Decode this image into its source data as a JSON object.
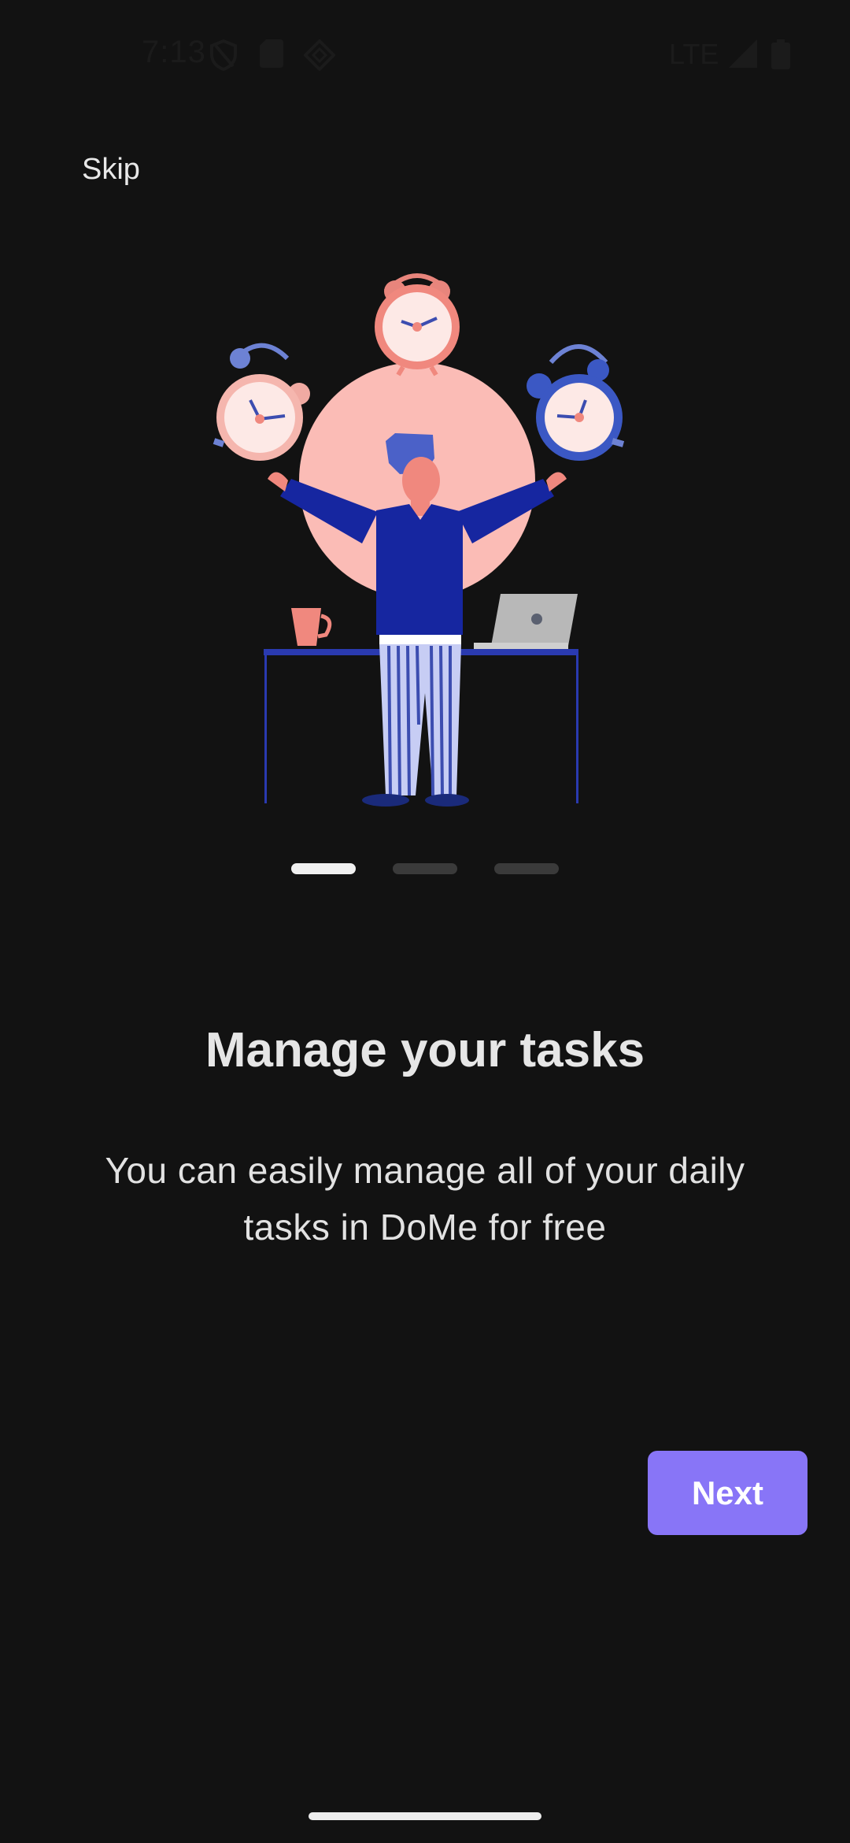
{
  "status_bar": {
    "time": "7:13",
    "network": "LTE",
    "icons": [
      "shield-icon",
      "sim-card-icon",
      "nfc-icon",
      "signal-icon",
      "battery-icon"
    ]
  },
  "onboarding": {
    "skip_label": "Skip",
    "title": "Manage your tasks",
    "description": "You can easily manage all of your daily tasks in DoMe for free",
    "next_label": "Next",
    "page_count": 3,
    "active_page": 0
  },
  "colors": {
    "background": "#121212",
    "accent": "#8875f7",
    "indicator_active": "#f0f0f0",
    "indicator_inactive": "#3a3a3a"
  }
}
